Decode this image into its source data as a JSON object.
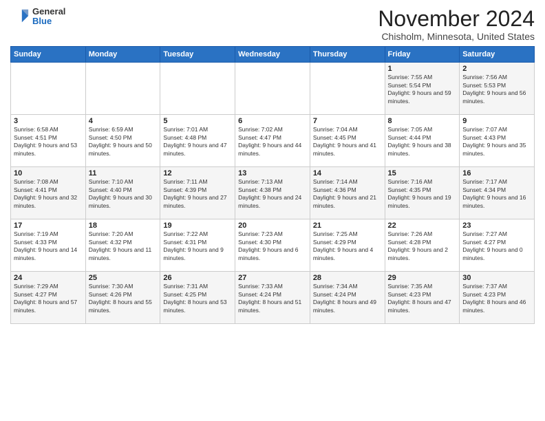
{
  "logo": {
    "general": "General",
    "blue": "Blue"
  },
  "title": "November 2024",
  "subtitle": "Chisholm, Minnesota, United States",
  "headers": [
    "Sunday",
    "Monday",
    "Tuesday",
    "Wednesday",
    "Thursday",
    "Friday",
    "Saturday"
  ],
  "weeks": [
    [
      {
        "day": "",
        "detail": ""
      },
      {
        "day": "",
        "detail": ""
      },
      {
        "day": "",
        "detail": ""
      },
      {
        "day": "",
        "detail": ""
      },
      {
        "day": "",
        "detail": ""
      },
      {
        "day": "1",
        "detail": "Sunrise: 7:55 AM\nSunset: 5:54 PM\nDaylight: 9 hours and 59 minutes."
      },
      {
        "day": "2",
        "detail": "Sunrise: 7:56 AM\nSunset: 5:53 PM\nDaylight: 9 hours and 56 minutes."
      }
    ],
    [
      {
        "day": "3",
        "detail": "Sunrise: 6:58 AM\nSunset: 4:51 PM\nDaylight: 9 hours and 53 minutes."
      },
      {
        "day": "4",
        "detail": "Sunrise: 6:59 AM\nSunset: 4:50 PM\nDaylight: 9 hours and 50 minutes."
      },
      {
        "day": "5",
        "detail": "Sunrise: 7:01 AM\nSunset: 4:48 PM\nDaylight: 9 hours and 47 minutes."
      },
      {
        "day": "6",
        "detail": "Sunrise: 7:02 AM\nSunset: 4:47 PM\nDaylight: 9 hours and 44 minutes."
      },
      {
        "day": "7",
        "detail": "Sunrise: 7:04 AM\nSunset: 4:45 PM\nDaylight: 9 hours and 41 minutes."
      },
      {
        "day": "8",
        "detail": "Sunrise: 7:05 AM\nSunset: 4:44 PM\nDaylight: 9 hours and 38 minutes."
      },
      {
        "day": "9",
        "detail": "Sunrise: 7:07 AM\nSunset: 4:43 PM\nDaylight: 9 hours and 35 minutes."
      }
    ],
    [
      {
        "day": "10",
        "detail": "Sunrise: 7:08 AM\nSunset: 4:41 PM\nDaylight: 9 hours and 32 minutes."
      },
      {
        "day": "11",
        "detail": "Sunrise: 7:10 AM\nSunset: 4:40 PM\nDaylight: 9 hours and 30 minutes."
      },
      {
        "day": "12",
        "detail": "Sunrise: 7:11 AM\nSunset: 4:39 PM\nDaylight: 9 hours and 27 minutes."
      },
      {
        "day": "13",
        "detail": "Sunrise: 7:13 AM\nSunset: 4:38 PM\nDaylight: 9 hours and 24 minutes."
      },
      {
        "day": "14",
        "detail": "Sunrise: 7:14 AM\nSunset: 4:36 PM\nDaylight: 9 hours and 21 minutes."
      },
      {
        "day": "15",
        "detail": "Sunrise: 7:16 AM\nSunset: 4:35 PM\nDaylight: 9 hours and 19 minutes."
      },
      {
        "day": "16",
        "detail": "Sunrise: 7:17 AM\nSunset: 4:34 PM\nDaylight: 9 hours and 16 minutes."
      }
    ],
    [
      {
        "day": "17",
        "detail": "Sunrise: 7:19 AM\nSunset: 4:33 PM\nDaylight: 9 hours and 14 minutes."
      },
      {
        "day": "18",
        "detail": "Sunrise: 7:20 AM\nSunset: 4:32 PM\nDaylight: 9 hours and 11 minutes."
      },
      {
        "day": "19",
        "detail": "Sunrise: 7:22 AM\nSunset: 4:31 PM\nDaylight: 9 hours and 9 minutes."
      },
      {
        "day": "20",
        "detail": "Sunrise: 7:23 AM\nSunset: 4:30 PM\nDaylight: 9 hours and 6 minutes."
      },
      {
        "day": "21",
        "detail": "Sunrise: 7:25 AM\nSunset: 4:29 PM\nDaylight: 9 hours and 4 minutes."
      },
      {
        "day": "22",
        "detail": "Sunrise: 7:26 AM\nSunset: 4:28 PM\nDaylight: 9 hours and 2 minutes."
      },
      {
        "day": "23",
        "detail": "Sunrise: 7:27 AM\nSunset: 4:27 PM\nDaylight: 9 hours and 0 minutes."
      }
    ],
    [
      {
        "day": "24",
        "detail": "Sunrise: 7:29 AM\nSunset: 4:27 PM\nDaylight: 8 hours and 57 minutes."
      },
      {
        "day": "25",
        "detail": "Sunrise: 7:30 AM\nSunset: 4:26 PM\nDaylight: 8 hours and 55 minutes."
      },
      {
        "day": "26",
        "detail": "Sunrise: 7:31 AM\nSunset: 4:25 PM\nDaylight: 8 hours and 53 minutes."
      },
      {
        "day": "27",
        "detail": "Sunrise: 7:33 AM\nSunset: 4:24 PM\nDaylight: 8 hours and 51 minutes."
      },
      {
        "day": "28",
        "detail": "Sunrise: 7:34 AM\nSunset: 4:24 PM\nDaylight: 8 hours and 49 minutes."
      },
      {
        "day": "29",
        "detail": "Sunrise: 7:35 AM\nSunset: 4:23 PM\nDaylight: 8 hours and 47 minutes."
      },
      {
        "day": "30",
        "detail": "Sunrise: 7:37 AM\nSunset: 4:23 PM\nDaylight: 8 hours and 46 minutes."
      }
    ]
  ]
}
